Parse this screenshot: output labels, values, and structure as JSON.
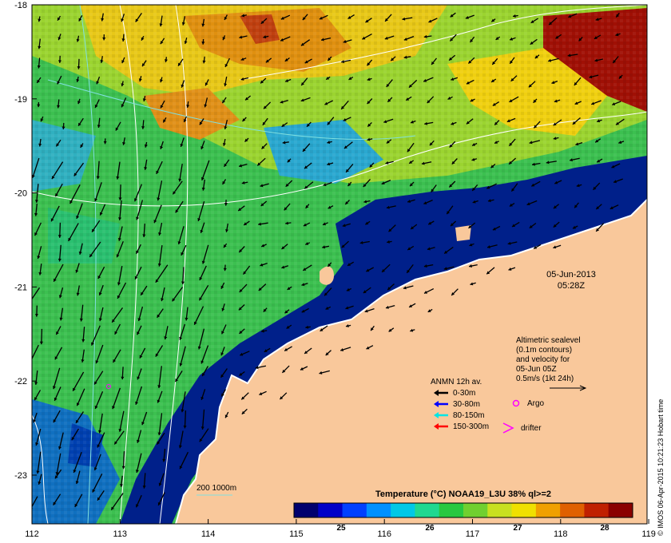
{
  "map": {
    "x_ticks": [
      "112",
      "113",
      "114",
      "115",
      "116",
      "117",
      "118",
      "119"
    ],
    "y_ticks": [
      "-18",
      "-19",
      "-20",
      "-21",
      "-22",
      "-23"
    ],
    "date_line1": "05-Jun-2013",
    "date_line2": "05:28Z",
    "altimetry_note": [
      "Altimetric sealevel",
      "(0.1m contours)",
      "and velocity for",
      "05-Jun 05Z",
      "0.5m/s (1kt 24h)"
    ],
    "bathymetry_label": "200  1000m",
    "credit": "© IMOS 06-Apr-2015 10:21:23 Hobart time"
  },
  "legend": {
    "title": "ANMN 12h av.",
    "items": [
      {
        "label": "0-30m",
        "color": "#000000"
      },
      {
        "label": "30-80m",
        "color": "#0000ff"
      },
      {
        "label": "80-150m",
        "color": "#00e5e5"
      },
      {
        "label": "150-300m",
        "color": "#ff0000"
      }
    ],
    "argo_label": "Argo",
    "drifter_label": "drifter",
    "argo_color": "#ff00ff",
    "drifter_color": "#ff00ff"
  },
  "colorbar": {
    "title": "Temperature (°C) NOAA19_L3U 38% ql>=2",
    "ticks": [
      "25",
      "26",
      "27",
      "28"
    ],
    "colors": [
      "#00006e",
      "#0000c8",
      "#0040ff",
      "#0090ff",
      "#00c8e6",
      "#20d890",
      "#28c840",
      "#70d030",
      "#c8e020",
      "#f0e000",
      "#f0a000",
      "#e06000",
      "#c02000",
      "#8a0000"
    ]
  },
  "colors": {
    "land": "#f9c89b",
    "coast_water": "#000080",
    "contour": "#ffffff",
    "isobath": "#80e0e0"
  }
}
